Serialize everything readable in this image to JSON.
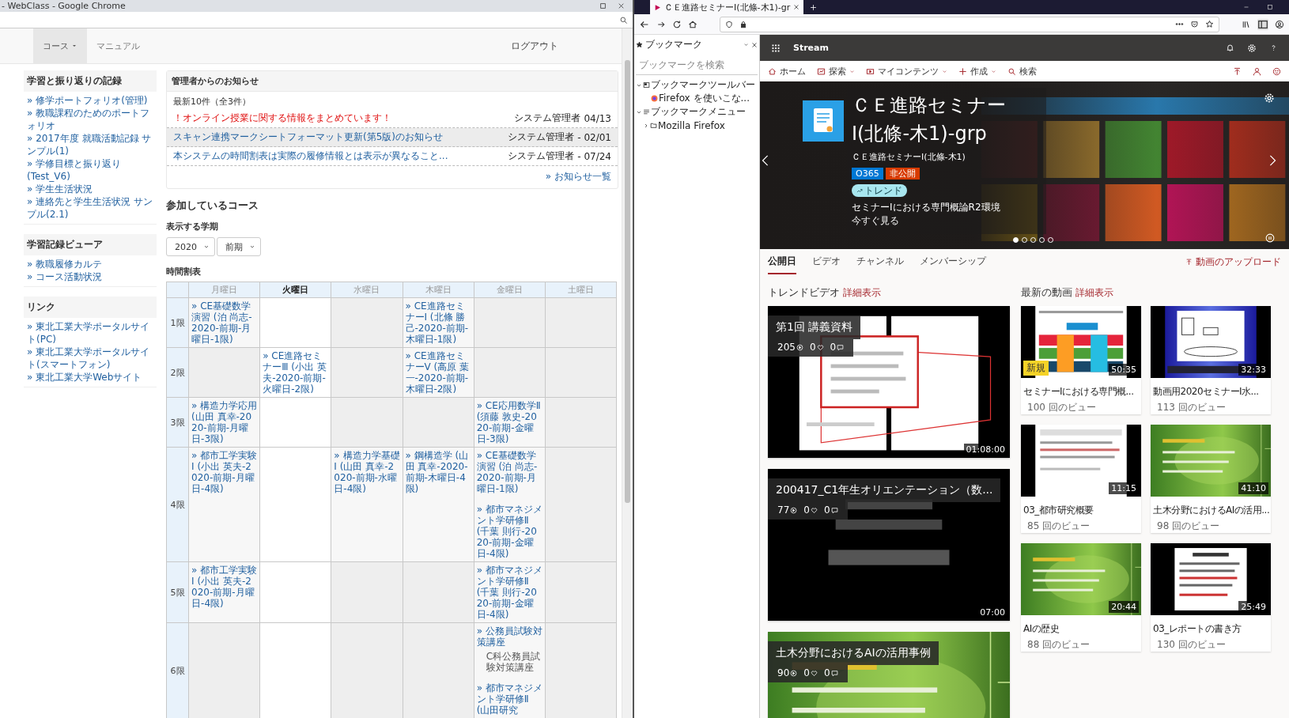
{
  "chrome": {
    "title": "- WebClass - Google Chrome",
    "nav": [
      {
        "label": "コース",
        "selected": true,
        "dropdown": true
      },
      {
        "label": "マニュアル",
        "selected": false,
        "dropdown": false
      }
    ],
    "logout": "ログアウト",
    "sidebar": [
      {
        "heading": "学習と振り返りの記録",
        "links": [
          "» 修学ポートフォリオ(管理)",
          "» 教職課程のためのポートフォリオ",
          "» 2017年度 就職活動記録 サンプル(1)",
          "» 学修目標と振り返り(Test_V6)",
          "» 学生生活状況",
          "» 連絡先と学生生活状況 サンプル(2.1)"
        ]
      },
      {
        "heading": "学習記録ビューア",
        "links": [
          "» 教職履修カルテ",
          "» コース活動状況"
        ]
      },
      {
        "heading": "リンク",
        "links": [
          "» 東北工業大学ポータルサイト(PC)",
          "» 東北工業大学ポータルサイト(スマートフォン)",
          "» 東北工業大学Webサイト"
        ]
      }
    ],
    "notices": {
      "heading": "管理者からのお知らせ",
      "count": "最新10件（全3件）",
      "items": [
        {
          "title": "！オンライン授業に関する情報をまとめています！",
          "author": "システム管理者",
          "date": "04/13",
          "important": true,
          "highlighted": false
        },
        {
          "title": "スキャン連携マークシートフォーマット更新(第5版)のお知らせ",
          "author": "システム管理者",
          "date": "- 02/01",
          "important": false,
          "highlighted": true
        },
        {
          "title": "本システムの時間割表は実際の履修情報とは表示が異なること...",
          "author": "システム管理者",
          "date": "- 07/24",
          "important": false,
          "highlighted": false
        }
      ],
      "more": "» お知らせ一覧"
    },
    "courses_heading": "参加しているコース",
    "term": {
      "label": "表示する学期",
      "year": "2020",
      "semester": "前期"
    },
    "timetable": {
      "heading": "時間割表",
      "days": [
        {
          "label": "月曜日",
          "today": false
        },
        {
          "label": "火曜日",
          "today": true
        },
        {
          "label": "水曜日",
          "today": false
        },
        {
          "label": "木曜日",
          "today": false
        },
        {
          "label": "金曜日",
          "today": false
        },
        {
          "label": "土曜日",
          "today": false
        }
      ],
      "rows": [
        {
          "period": "1限",
          "cells": [
            [
              {
                "kind": "link",
                "text": "» CE基礎数学演習 (泊 尚志-2020-前期-月曜日-1限)"
              }
            ],
            [],
            [],
            [
              {
                "kind": "link",
                "text": "» CE進路セミナーⅠ (北條 勝己-2020-前期-木曜日-1限)"
              }
            ],
            [],
            []
          ]
        },
        {
          "period": "2限",
          "cells": [
            [],
            [
              {
                "kind": "link",
                "text": "» CE進路セミナーⅢ (小出 英夫-2020-前期-火曜日-2限)"
              }
            ],
            [],
            [
              {
                "kind": "link",
                "text": "» CE進路セミナーⅤ (高原 葉一-2020-前期-木曜日-2限)"
              }
            ],
            [],
            []
          ]
        },
        {
          "period": "3限",
          "cells": [
            [
              {
                "kind": "link",
                "text": "» 構造力学応用 (山田 真幸-2020-前期-月曜日-3限)"
              }
            ],
            [],
            [],
            [],
            [
              {
                "kind": "link",
                "text": "» CE応用数学Ⅱ (須藤 敦史-2020-前期-金曜日-3限)"
              }
            ],
            []
          ]
        },
        {
          "period": "4限",
          "cells": [
            [
              {
                "kind": "link",
                "text": "» 都市工学実験Ⅰ (小出 英夫-2020-前期-月曜日-4限)"
              }
            ],
            [],
            [
              {
                "kind": "link",
                "text": "» 構造力学基礎Ⅰ (山田 真幸-2020-前期-水曜日-4限)"
              }
            ],
            [
              {
                "kind": "link",
                "text": "» 鋼構造学 (山田 真幸-2020-前期-木曜日-4限)"
              }
            ],
            [
              {
                "kind": "link",
                "text": "» CE基礎数学演習 (泊 尚志-2020-前期-月曜日-1限)"
              },
              {
                "kind": "link",
                "text": "» 都市マネジメント学研修Ⅱ (千葉 則行-2020-前期-金曜日-4限)"
              }
            ],
            []
          ]
        },
        {
          "period": "5限",
          "cells": [
            [
              {
                "kind": "link",
                "text": "» 都市工学実験Ⅰ (小出 英夫-2020-前期-月曜日-4限)"
              }
            ],
            [],
            [],
            [],
            [
              {
                "kind": "link",
                "text": "» 都市マネジメント学研修Ⅱ (千葉 則行-2020-前期-金曜日-4限)"
              }
            ],
            []
          ]
        },
        {
          "period": "6限",
          "cells": [
            [],
            [],
            [],
            [],
            [
              {
                "kind": "link",
                "text": "» 公務員試験対策講座"
              },
              {
                "kind": "note",
                "text": "C科公務員試験対策講座"
              },
              {
                "kind": "link",
                "text": "» 都市マネジメント学研修Ⅱ (山田研究"
              }
            ],
            []
          ]
        }
      ]
    }
  },
  "firefox": {
    "tab_title": "ＣＥ進路セミナーⅠ(北條-木1)-gr",
    "bookmarks": {
      "title": "ブックマーク",
      "search_placeholder": "ブックマークを検索",
      "tree": [
        {
          "label": "ブックマークツールバー",
          "kind": "toolbar",
          "expanded": true,
          "children": [
            {
              "label": "Firefox を使いこな...",
              "kind": "page"
            }
          ]
        },
        {
          "label": "ブックマークメニュー",
          "kind": "menu",
          "expanded": true,
          "children": [
            {
              "label": "Mozilla Firefox",
              "kind": "folder",
              "expanded": false
            }
          ]
        }
      ]
    }
  },
  "stream": {
    "app_name": "Stream",
    "nav": [
      {
        "label": "ホーム",
        "dropdown": false
      },
      {
        "label": "探索",
        "dropdown": true
      },
      {
        "label": "マイコンテンツ",
        "dropdown": true
      },
      {
        "label": "作成",
        "dropdown": true
      },
      {
        "label": "検索",
        "dropdown": false
      }
    ],
    "hero": {
      "title": "ＣＥ進路セミナーⅠ(北條-木1)-grp",
      "subtitle": "ＣＥ進路セミナーⅠ(北條-木1)",
      "tags": [
        {
          "label": "O365",
          "color": "#0078d4"
        },
        {
          "label": "非公開",
          "color": "#d83b01"
        }
      ],
      "trend_tag": "トレンド",
      "video_title": "セミナーⅠにおける専門概論R2環境",
      "watch": "今すぐ見る",
      "slides": [
        {
          "selected": true
        },
        {
          "selected": false
        },
        {
          "selected": false
        },
        {
          "selected": false
        },
        {
          "selected": false
        }
      ]
    },
    "tabs": [
      {
        "label": "公開日",
        "selected": true
      },
      {
        "label": "ビデオ",
        "selected": false
      },
      {
        "label": "チャンネル",
        "selected": false
      },
      {
        "label": "メンバーシップ",
        "selected": false
      }
    ],
    "upload": "動画のアップロード",
    "trending": {
      "heading": "トレンドビデオ",
      "more": "詳細表示",
      "videos": [
        {
          "title": "第1回 講義資料",
          "views": "205",
          "likes": "0",
          "comments": "0",
          "duration": "01:08:00"
        },
        {
          "title": "200417_C1年生オリエンテーション（数...",
          "views": "77",
          "likes": "0",
          "comments": "0",
          "duration": "07:00"
        },
        {
          "title": "土木分野におけるAIの活用事例",
          "views": "90",
          "likes": "0",
          "comments": "0"
        }
      ]
    },
    "latest": {
      "heading": "最新の動画",
      "more": "詳細表示",
      "videos": [
        {
          "title": "セミナーⅠにおける専門概...",
          "views": "100 回のビュー",
          "duration": "50:35",
          "badge": "新規"
        },
        {
          "title": "動画用2020セミナーⅠ水...",
          "views": "113 回のビュー",
          "duration": "32:33"
        },
        {
          "title": "03_都市研究概要",
          "views": "85 回のビュー",
          "duration": "11:15"
        },
        {
          "title": "土木分野におけるAIの活用...",
          "views": "98 回のビュー",
          "duration": "41:10"
        },
        {
          "title": "AIの歴史",
          "views": "88 回のビュー",
          "duration": "20:44"
        },
        {
          "title": "03_レポートの書き方",
          "views": "130 回のビュー",
          "duration": "25:49"
        }
      ]
    }
  }
}
